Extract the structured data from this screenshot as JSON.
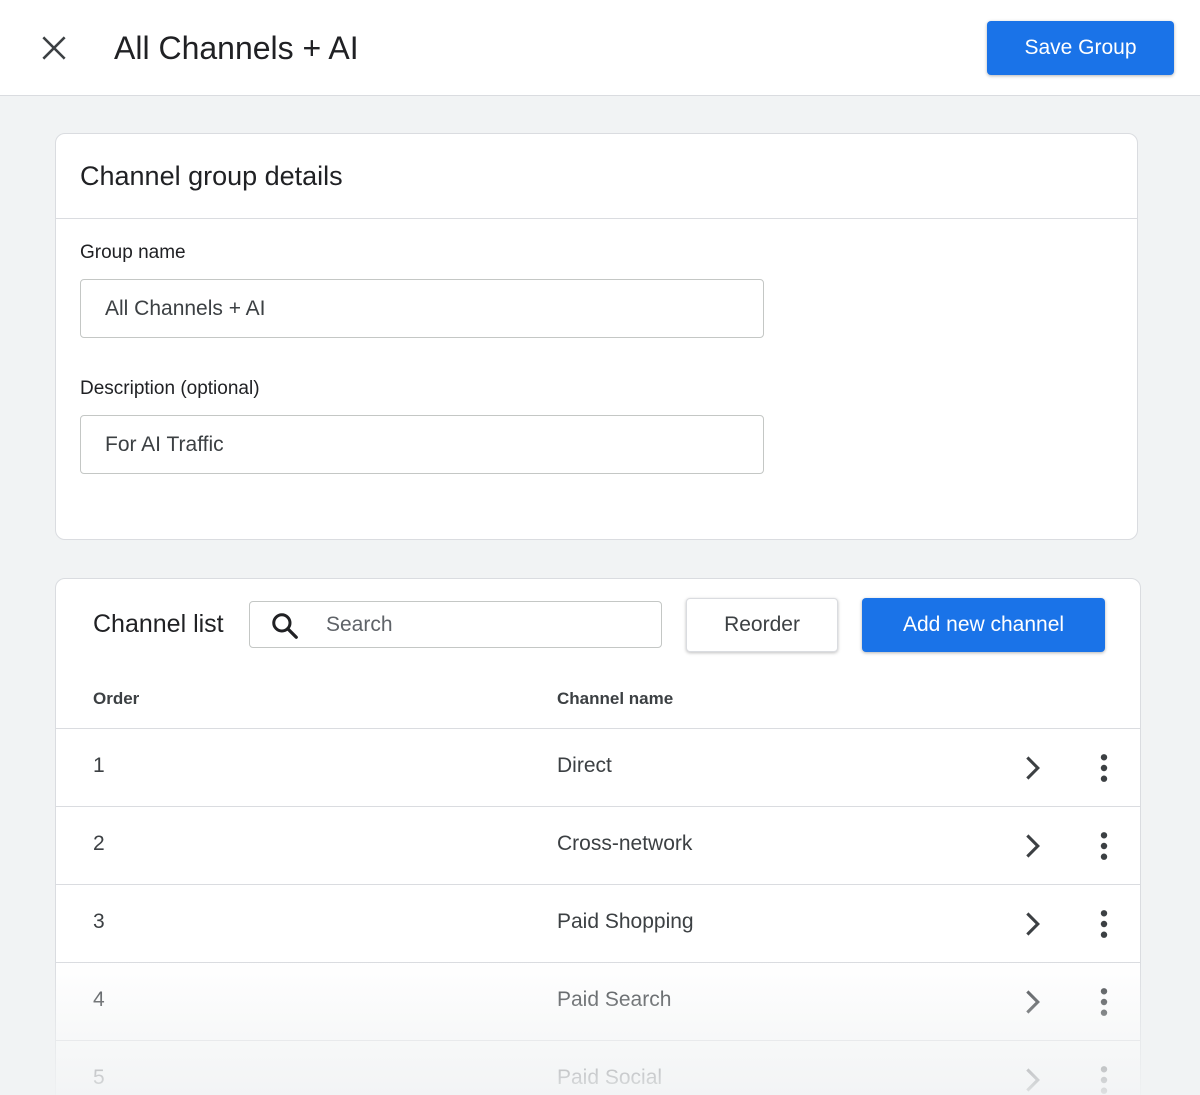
{
  "header": {
    "title": "All Channels + AI",
    "save_label": "Save Group"
  },
  "details": {
    "title": "Channel group details",
    "group_name_label": "Group name",
    "group_name_value": "All Channels + AI",
    "description_label": "Description (optional)",
    "description_value": "For AI Traffic"
  },
  "channel_list": {
    "title": "Channel list",
    "search_placeholder": "Search",
    "reorder_label": "Reorder",
    "add_label": "Add new channel",
    "columns": {
      "order": "Order",
      "name": "Channel name"
    },
    "rows": [
      {
        "order": "1",
        "name": "Direct"
      },
      {
        "order": "2",
        "name": "Cross-network"
      },
      {
        "order": "3",
        "name": "Paid Shopping"
      },
      {
        "order": "4",
        "name": "Paid Search"
      },
      {
        "order": "5",
        "name": "Paid Social"
      }
    ]
  },
  "icons": {
    "close": "close-icon",
    "search": "search-icon",
    "chevron": "chevron-right-icon",
    "menu": "more-vert-icon"
  },
  "colors": {
    "primary": "#1a73e8",
    "background": "#f1f3f4",
    "border": "#dadce0",
    "text": "#202124"
  }
}
